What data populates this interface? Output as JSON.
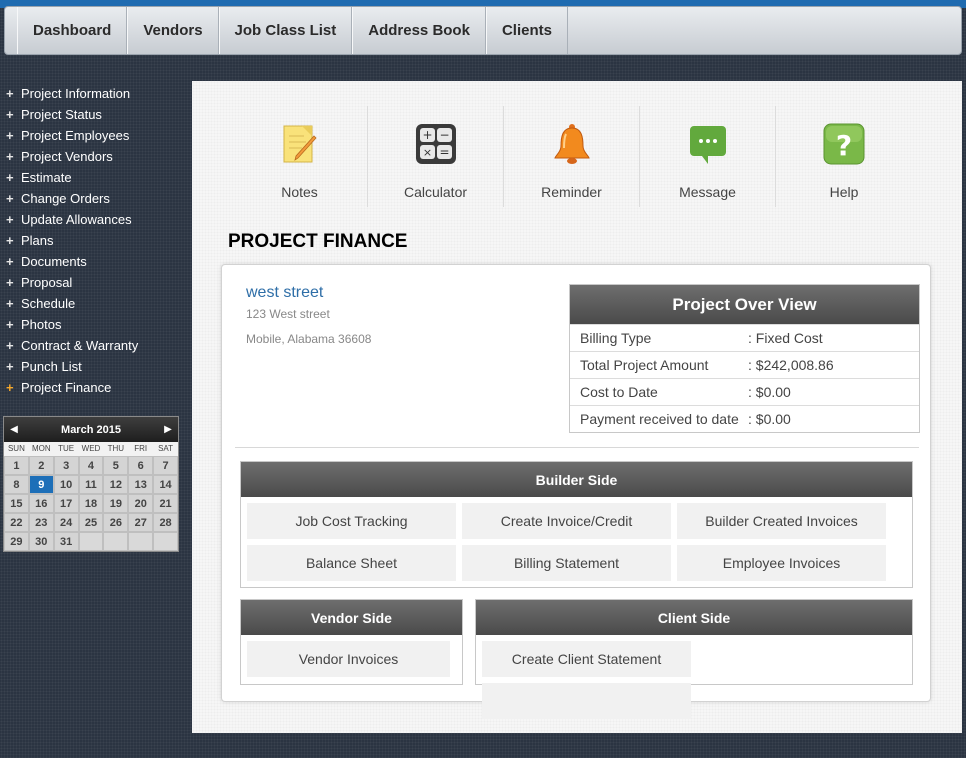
{
  "nav": [
    "Dashboard",
    "Vendors",
    "Job Class List",
    "Address Book",
    "Clients"
  ],
  "sidebar": [
    "Project Information",
    "Project Status",
    "Project Employees",
    "Project Vendors",
    "Estimate",
    "Change Orders",
    "Update Allowances",
    "Plans",
    "Documents",
    "Proposal",
    "Schedule",
    "Photos",
    "Contract & Warranty",
    "Punch List",
    "Project Finance"
  ],
  "calendar": {
    "title": "March 2015",
    "dow": [
      "SUN",
      "MON",
      "TUE",
      "WED",
      "THU",
      "FRI",
      "SAT"
    ],
    "days": [
      "1",
      "2",
      "3",
      "4",
      "5",
      "6",
      "7",
      "8",
      "9",
      "10",
      "11",
      "12",
      "13",
      "14",
      "15",
      "16",
      "17",
      "18",
      "19",
      "20",
      "21",
      "22",
      "23",
      "24",
      "25",
      "26",
      "27",
      "28",
      "29",
      "30",
      "31"
    ],
    "today": "9"
  },
  "tools": [
    "Notes",
    "Calculator",
    "Reminder",
    "Message",
    "Help"
  ],
  "page_title": "PROJECT FINANCE",
  "project": {
    "name": "west street",
    "address1": "123 West street",
    "address2": "Mobile, Alabama 36608"
  },
  "overview": {
    "title": "Project Over View",
    "rows": [
      {
        "label": "Billing Type",
        "value": ": Fixed Cost"
      },
      {
        "label": "Total Project Amount",
        "value": ": $242,008.86"
      },
      {
        "label": "Cost to Date",
        "value": ": $0.00"
      },
      {
        "label": "Payment received to date",
        "value": ": $0.00"
      }
    ]
  },
  "builder": {
    "title": "Builder Side",
    "buttons": [
      "Job Cost Tracking",
      "Create Invoice/Credit",
      "Builder Created Invoices",
      "Balance Sheet",
      "Billing Statement",
      "Employee Invoices"
    ]
  },
  "vendor": {
    "title": "Vendor Side",
    "buttons": [
      "Vendor Invoices"
    ]
  },
  "client": {
    "title": "Client Side",
    "buttons": [
      "Create Client Statement",
      ""
    ]
  }
}
